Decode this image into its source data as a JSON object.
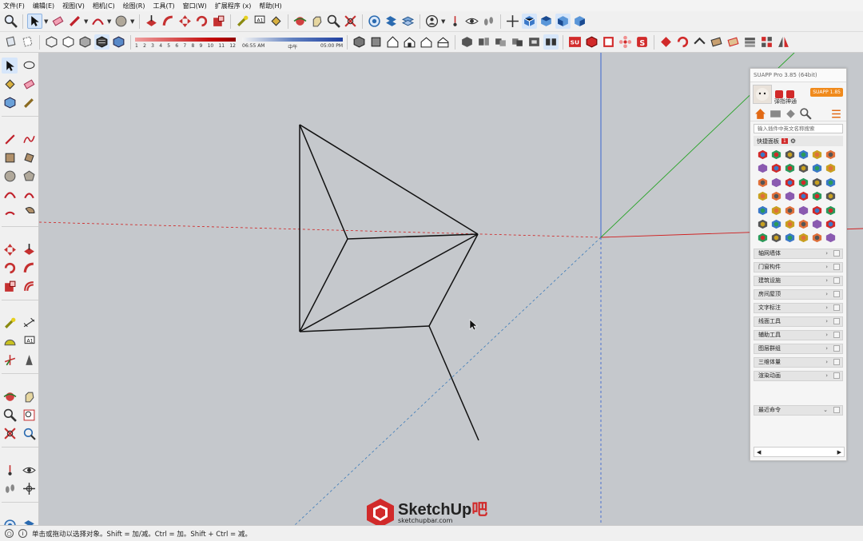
{
  "menu": [
    "文件(F)",
    "编辑(E)",
    "视图(V)",
    "相机(C)",
    "绘图(R)",
    "工具(T)",
    "窗口(W)",
    "扩展程序 (x)",
    "帮助(H)"
  ],
  "shadow": {
    "month_ticks": [
      "1",
      "2",
      "3",
      "4",
      "5",
      "6",
      "7",
      "8",
      "9",
      "10",
      "11",
      "12"
    ],
    "time_start": "06:55 AM",
    "time_mid": "中午",
    "time_end": "05:00 PM"
  },
  "watermark": {
    "brand_main": "SketchUp",
    "brand_suffix": "吧",
    "site": "sketchupbar.com"
  },
  "suapp": {
    "title": "SUAPP Pro 3.85 (64bit)",
    "username": "弹指神通",
    "version_badge": "SUAPP 1.85",
    "search_placeholder": "输入插件中英文名称搜索",
    "quick_panel_label": "快捷面板",
    "quick_panel_count": "1",
    "categories": [
      "轴网墙体",
      "门窗构件",
      "建筑设施",
      "房间屋顶",
      "文字标注",
      "线面工具",
      "辅助工具",
      "图层群组",
      "三维体量",
      "渲染动画"
    ],
    "recent_label": "最近命令"
  },
  "status": {
    "message": "单击或拖动以选择对象。Shift = 加/减。Ctrl = 加。Shift + Ctrl = 减。"
  },
  "colors": {
    "viewport": "#c5c8cc",
    "accent_red": "#d12a2a",
    "badge_orange": "#f08a1c",
    "axis_red": "#d02020",
    "axis_green": "#27a327",
    "axis_blue": "#2d5bd1"
  }
}
